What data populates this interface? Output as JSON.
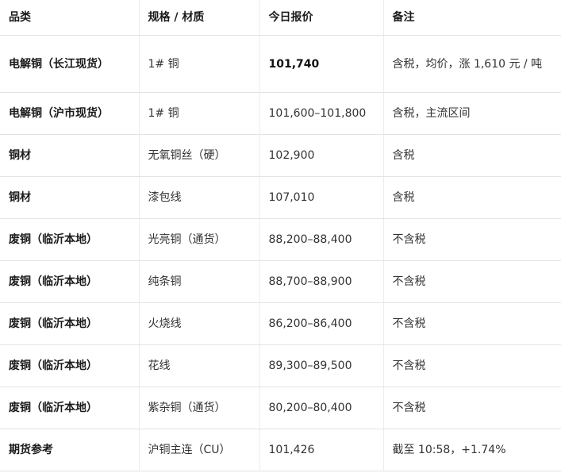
{
  "table": {
    "headers": [
      "品类",
      "规格 / 材质",
      "今日报价",
      "备注"
    ],
    "rows": [
      {
        "category": "电解铜（长江现货）",
        "spec": "1# 铜",
        "price": "101,740",
        "note": "含税，均价，涨 1,610 元 / 吨"
      },
      {
        "category": "电解铜（沪市现货）",
        "spec": "1# 铜",
        "price": "101,600–101,800",
        "note": "含税，主流区间"
      },
      {
        "category": "铜材",
        "spec": "无氧铜丝（硬）",
        "price": "102,900",
        "note": "含税"
      },
      {
        "category": "铜材",
        "spec": "漆包线",
        "price": "107,010",
        "note": "含税"
      },
      {
        "category": "废铜（临沂本地）",
        "spec": "光亮铜（通货）",
        "price": "88,200–88,400",
        "note": "不含税"
      },
      {
        "category": "废铜（临沂本地）",
        "spec": "纯条铜",
        "price": "88,700–88,900",
        "note": "不含税"
      },
      {
        "category": "废铜（临沂本地）",
        "spec": "火烧线",
        "price": "86,200–86,400",
        "note": "不含税"
      },
      {
        "category": "废铜（临沂本地）",
        "spec": "花线",
        "price": "89,300–89,500",
        "note": "不含税"
      },
      {
        "category": "废铜（临沂本地）",
        "spec": "紫杂铜（通货）",
        "price": "80,200–80,400",
        "note": "不含税"
      },
      {
        "category": "期货参考",
        "spec": "沪铜主连（CU）",
        "price": "101,426",
        "note": "截至 10:58，+1.74%"
      }
    ]
  }
}
